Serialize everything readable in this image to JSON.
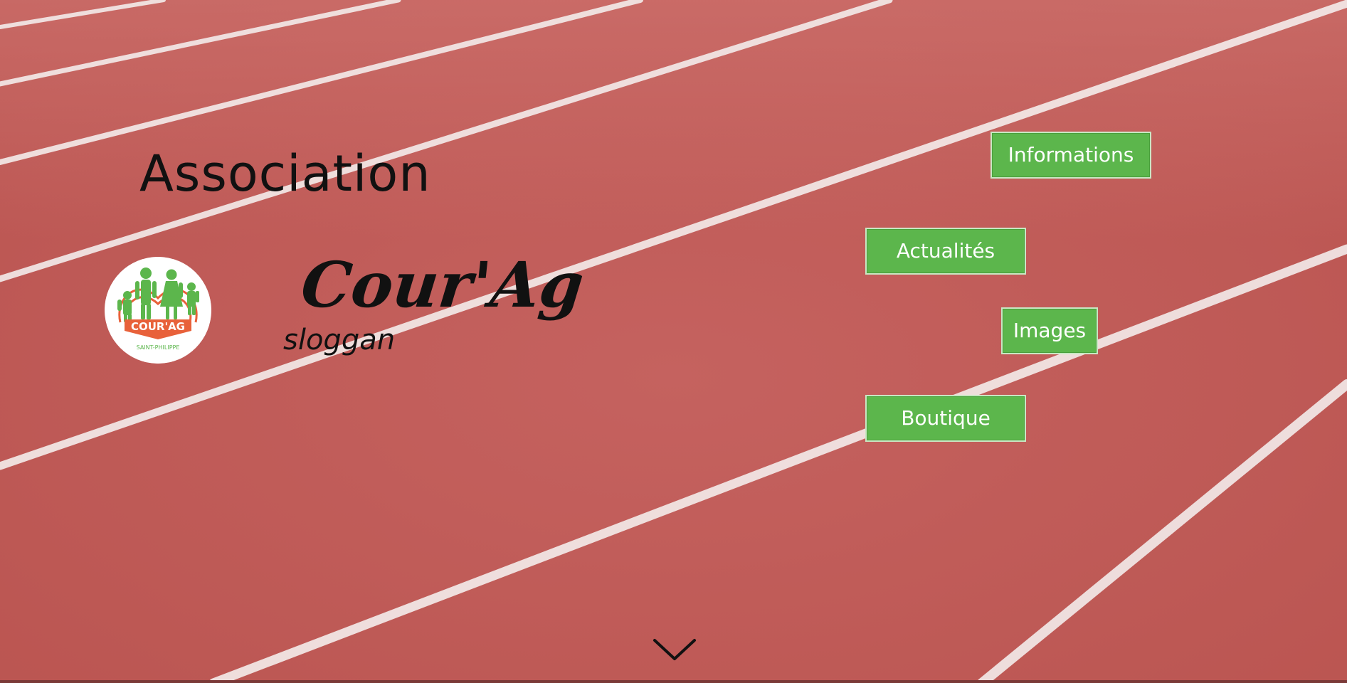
{
  "header": {
    "title": "Association"
  },
  "brand": {
    "logo_text": "COUR'AG",
    "logo_subtext": "SAINT-PHILIPPE",
    "name": "Cour'Ag",
    "slogan": "sloggan"
  },
  "nav": {
    "items": [
      {
        "label": "Informations"
      },
      {
        "label": "Actualités"
      },
      {
        "label": "Images"
      },
      {
        "label": "Boutique"
      }
    ]
  },
  "icons": {
    "scroll_down": "chevron-down-icon"
  },
  "colors": {
    "track": "#c25f5c",
    "lane_line": "#f4eeee",
    "button_bg": "#5cb64c",
    "logo_green": "#5cb64c",
    "logo_orange": "#e8613a"
  }
}
